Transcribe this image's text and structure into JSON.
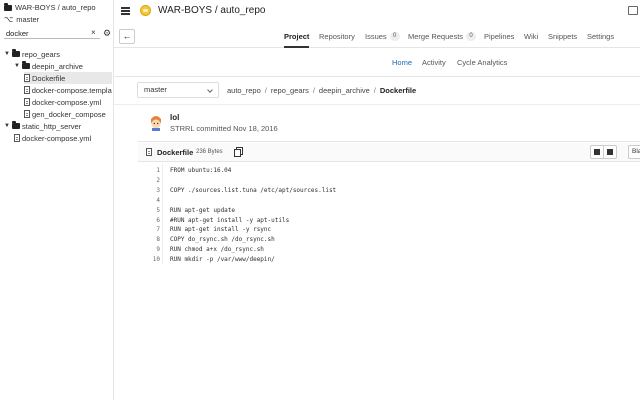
{
  "sidebar": {
    "header": "WAR-BOYS / auto_repo",
    "branch": "master",
    "search_value": "docker",
    "clear_glyph": "×",
    "tree": [
      {
        "label": "repo_gears",
        "type": "folder",
        "depth": 0,
        "expanded": true
      },
      {
        "label": "deepin_archive",
        "type": "folder",
        "depth": 1,
        "expanded": true
      },
      {
        "label": "Dockerfile",
        "type": "file",
        "depth": 2,
        "selected": true
      },
      {
        "label": "docker-compose.template",
        "type": "file",
        "depth": 2
      },
      {
        "label": "docker-compose.yml",
        "type": "file",
        "depth": 2
      },
      {
        "label": "gen_docker_compose",
        "type": "file",
        "depth": 2
      },
      {
        "label": "static_http_server",
        "type": "folder",
        "depth": 0,
        "expanded": true
      },
      {
        "label": "docker-compose.yml",
        "type": "file",
        "depth": 1
      }
    ]
  },
  "topbar": {
    "title": "WAR-BOYS / auto_repo"
  },
  "nav": {
    "back_glyph": "←",
    "tabs": [
      {
        "label": "Project",
        "active": true
      },
      {
        "label": "Repository"
      },
      {
        "label": "Issues",
        "badge": "0"
      },
      {
        "label": "Merge Requests",
        "badge": "0"
      },
      {
        "label": "Pipelines"
      },
      {
        "label": "Wiki"
      },
      {
        "label": "Snippets"
      },
      {
        "label": "Settings"
      }
    ],
    "subtabs": [
      {
        "label": "Home",
        "active": true
      },
      {
        "label": "Activity"
      },
      {
        "label": "Cycle Analytics"
      }
    ]
  },
  "breadcrumb": {
    "branch": "master",
    "parts": [
      "auto_repo",
      "repo_gears",
      "deepin_archive",
      "Dockerfile"
    ],
    "separator": "/"
  },
  "commit": {
    "title": "lol",
    "meta": "STRRL committed Nov 18, 2016"
  },
  "file": {
    "name": "Dockerfile",
    "size": "236 Bytes",
    "blame_label": "Bla",
    "lines": [
      "FROM ubuntu:16.04",
      "",
      "COPY ./sources.list.tuna /etc/apt/sources.list",
      "",
      "RUN apt-get update",
      "#RUN apt-get install -y apt-utils",
      "RUN apt-get install -y rsync",
      "COPY do_rsync.sh /do_rsync.sh",
      "RUN chmod a+x /do_rsync.sh",
      "RUN mkdir -p /var/www/deepin/"
    ]
  },
  "colors": {
    "accent": "#1b69b6",
    "active_tab_underline": "#333333",
    "avatar_yellow": "#f5c542"
  }
}
